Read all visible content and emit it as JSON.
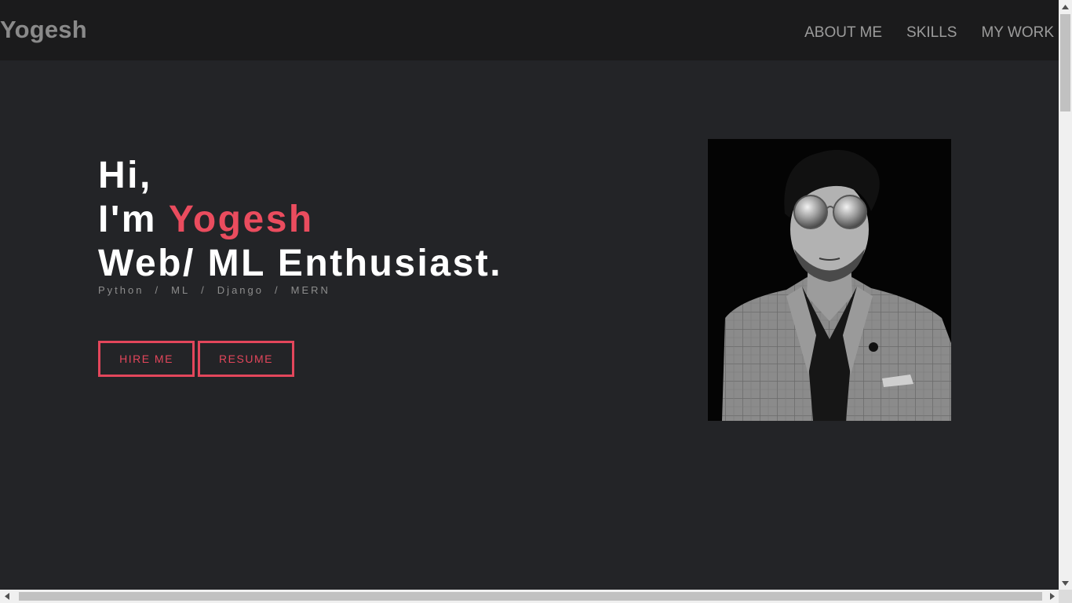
{
  "brand": {
    "name": "Yogesh"
  },
  "nav": {
    "links": [
      "ABOUT ME",
      "SKILLS",
      "MY WORK"
    ]
  },
  "hero": {
    "greeting": "Hi,",
    "intro_prefix": "I'm ",
    "name": "Yogesh",
    "role": "Web/ ML Enthusiast.",
    "tags": [
      "Python",
      "ML",
      "Django",
      "MERN"
    ],
    "tag_separator": "/"
  },
  "buttons": {
    "hire": "HIRE ME",
    "resume": "RESUME"
  },
  "colors": {
    "accent": "#ea4c5e",
    "background": "#232427",
    "navbar": "#1b1b1c"
  },
  "icons": {
    "portrait": "profile-photo"
  }
}
